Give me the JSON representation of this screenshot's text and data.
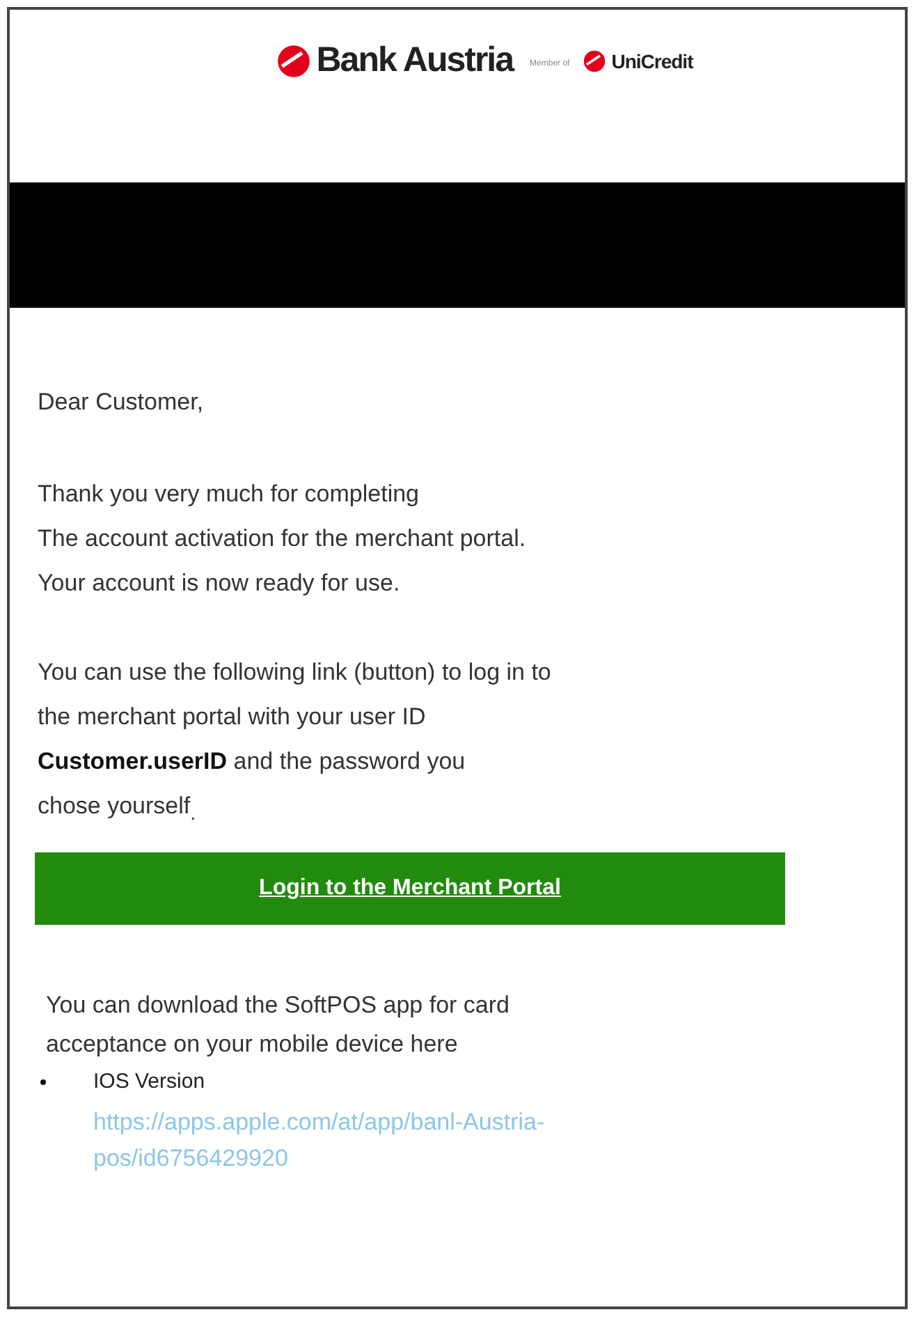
{
  "header": {
    "brand": "Bank Austria",
    "member_of": "Member of",
    "partner": "UniCredit"
  },
  "greeting": "Dear Customer,",
  "paragraphs": [
    {
      "lines": [
        "Thank you very much for completing",
        "The account activation for the merchant portal.",
        "Your account is now ready for use."
      ]
    },
    {
      "lines": [
        "You can use the following link (button) to log in to",
        " the merchant portal with your user ID",
        "**Customer.userID** and the password you",
        "chose yourself$_{.}$"
      ]
    }
  ],
  "login_button": "Login to the Merchant Portal",
  "download": {
    "lines": [
      "You can download the SoftPOS app for card",
      "acceptance on your mobile device here"
    ]
  },
  "bullets": [
    {
      "label": "IOS Version",
      "link_lines": [
        "https://apps.apple.com/at/app/banl-Austria-",
        "pos/id6756429920"
      ]
    }
  ]
}
